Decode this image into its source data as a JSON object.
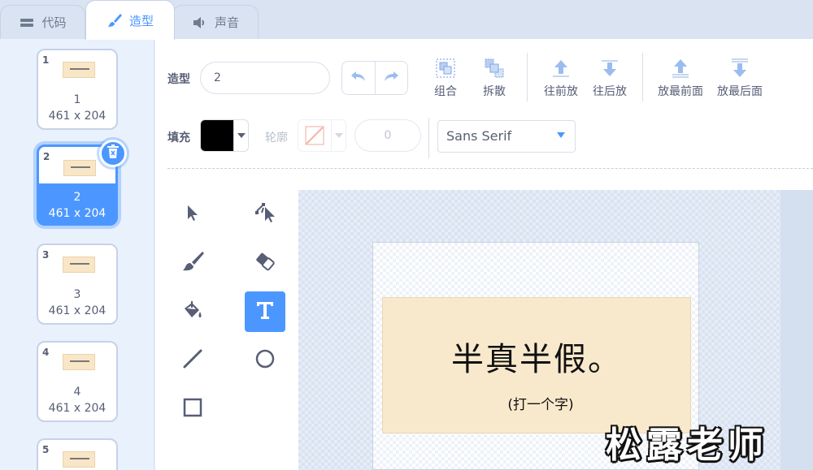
{
  "tabs": [
    {
      "label": "代码",
      "icon": "code-blocks-icon"
    },
    {
      "label": "造型",
      "icon": "brush-icon"
    },
    {
      "label": "声音",
      "icon": "speaker-icon"
    }
  ],
  "costumes": [
    {
      "index": "1",
      "name": "1",
      "size": "461 x 204"
    },
    {
      "index": "2",
      "name": "2",
      "size": "461 x 204"
    },
    {
      "index": "3",
      "name": "3",
      "size": "461 x 204"
    },
    {
      "index": "4",
      "name": "4",
      "size": "461 x 204"
    },
    {
      "index": "5",
      "name": "",
      "size": ""
    }
  ],
  "selected_costume": "2",
  "toolbar": {
    "costume_label": "造型",
    "costume_name": "2",
    "group": "组合",
    "ungroup": "拆散",
    "forward": "往前放",
    "backward": "往后放",
    "front": "放最前面",
    "back": "放最后面",
    "fill_label": "填充",
    "outline_label": "轮廓",
    "outline_width": "0",
    "font": "Sans Serif",
    "fill_color": "#000000"
  },
  "tools": [
    "select-tool",
    "reshape-tool",
    "brush-tool",
    "eraser-tool",
    "fill-tool",
    "text-tool",
    "line-tool",
    "circle-tool",
    "rectangle-tool"
  ],
  "active_tool": "text-tool",
  "canvas": {
    "title": "半真半假。",
    "subtitle": "(打一个字)"
  },
  "watermark": "松露老师",
  "colors": {
    "accent": "#4c97ff",
    "card": "#f9e9cc"
  }
}
